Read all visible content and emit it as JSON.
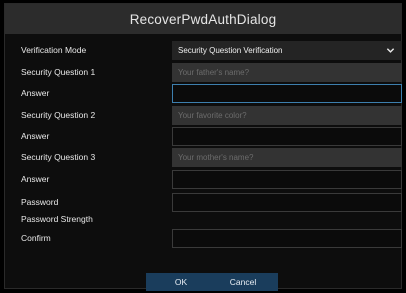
{
  "dialog": {
    "title": "RecoverPwdAuthDialog"
  },
  "form": {
    "verification_mode_label": "Verification Mode",
    "verification_mode_value": "Security Question Verification",
    "q1_label": "Security Question 1",
    "q1_value": "Your father's name?",
    "answer1_label": "Answer",
    "answer1_value": "",
    "q2_label": "Security Question 2",
    "q2_value": "Your favorite color?",
    "answer2_label": "Answer",
    "answer2_value": "",
    "q3_label": "Security Question 3",
    "q3_value": "Your mother's name?",
    "answer3_label": "Answer",
    "answer3_value": "",
    "password_label": "Password",
    "password_value": "",
    "strength_label": "Password Strength",
    "confirm_label": "Confirm",
    "confirm_value": ""
  },
  "buttons": {
    "ok_label": "OK",
    "cancel_label": "Cancel"
  },
  "colors": {
    "accent_focus": "#3d7fae",
    "button_bg": "#1a3d5c",
    "titlebar_bg": "#2c2c2c",
    "dialog_bg": "#0d0d0d"
  }
}
